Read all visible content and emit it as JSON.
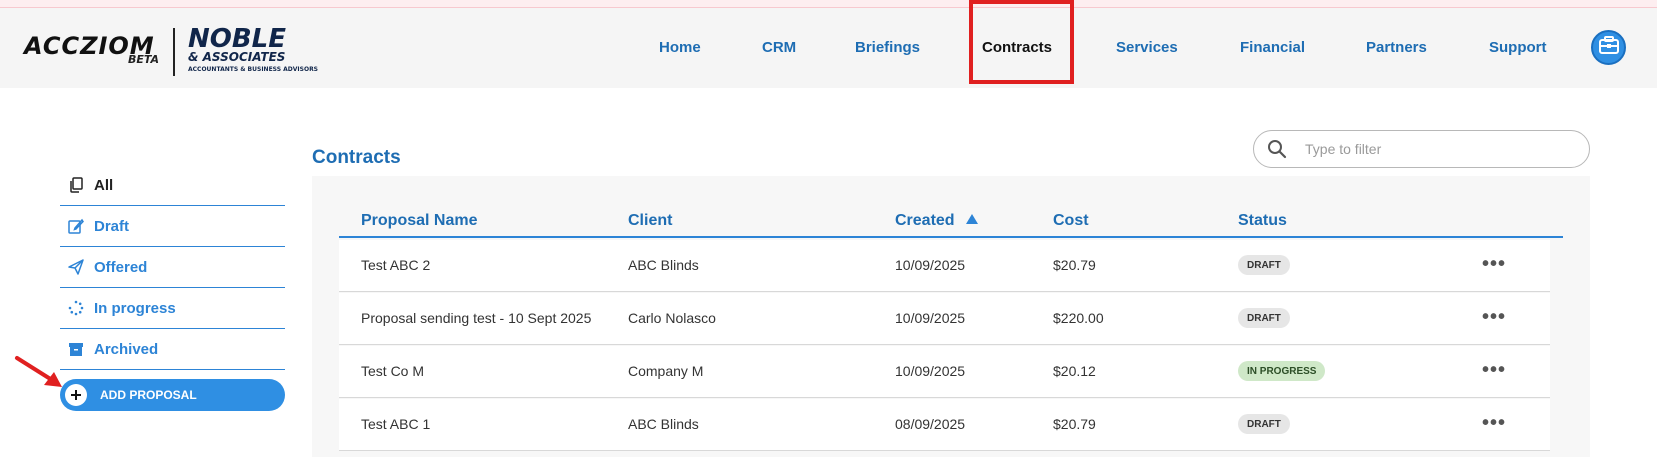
{
  "brand": {
    "logo_text": "ACCZIOM",
    "beta_label": "BETA",
    "partner_name": "NOBLE",
    "partner_sub": "& ASSOCIATES",
    "partner_tagline": "ACCOUNTANTS & BUSINESS ADVISORS"
  },
  "nav": {
    "items": [
      {
        "label": "Home"
      },
      {
        "label": "CRM"
      },
      {
        "label": "Briefings"
      },
      {
        "label": "Contracts",
        "active": true
      },
      {
        "label": "Services"
      },
      {
        "label": "Financial"
      },
      {
        "label": "Partners"
      },
      {
        "label": "Support"
      }
    ],
    "avatar_icon": "briefcase-icon"
  },
  "sidebar": {
    "items": [
      {
        "label": "All",
        "icon": "copy-icon",
        "active": true
      },
      {
        "label": "Draft",
        "icon": "edit-icon"
      },
      {
        "label": "Offered",
        "icon": "send-icon"
      },
      {
        "label": "In progress",
        "icon": "spinner-icon"
      },
      {
        "label": "Archived",
        "icon": "archive-icon"
      }
    ],
    "add_button_label": "ADD PROPOSAL"
  },
  "main": {
    "title": "Contracts",
    "search_placeholder": "Type to filter"
  },
  "table": {
    "columns": [
      "Proposal Name",
      "Client",
      "Created",
      "Cost",
      "Status"
    ],
    "sort_column": "Created",
    "sort_direction": "ascending",
    "rows": [
      {
        "name": "Test ABC 2",
        "client": "ABC Blinds",
        "created": "10/09/2025",
        "cost": "$20.79",
        "status": "DRAFT"
      },
      {
        "name": "Proposal sending test - 10 Sept 2025",
        "client": "Carlo Nolasco",
        "created": "10/09/2025",
        "cost": "$220.00",
        "status": "DRAFT"
      },
      {
        "name": "Test Co M",
        "client": "Company M",
        "created": "10/09/2025",
        "cost": "$20.12",
        "status": "IN PROGRESS"
      },
      {
        "name": "Test ABC 1",
        "client": "ABC Blinds",
        "created": "08/09/2025",
        "cost": "$20.79",
        "status": "DRAFT"
      }
    ],
    "row_menu_glyph": "•••"
  },
  "colors": {
    "accent": "#1e6db3",
    "button": "#2f8fe3",
    "highlight_box": "#e02020",
    "draft_badge": "#e6e6e6",
    "in_progress_badge": "#cfe8c8"
  }
}
